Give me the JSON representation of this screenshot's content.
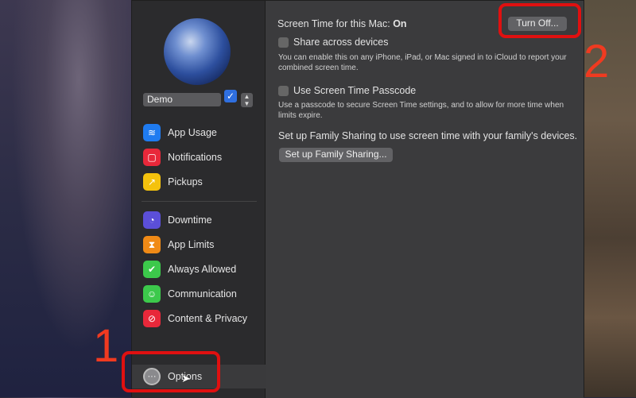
{
  "sidebar": {
    "user": "Demo",
    "groups": [
      {
        "label": "App Usage",
        "icon": "layers-icon",
        "color": "#1f7bf0"
      },
      {
        "label": "Notifications",
        "icon": "notification-icon",
        "color": "#e8283a"
      },
      {
        "label": "Pickups",
        "icon": "pickup-icon",
        "color": "#f4c20d"
      },
      {
        "label": "Downtime",
        "icon": "downtime-icon",
        "color": "#5b4fd8"
      },
      {
        "label": "App Limits",
        "icon": "hourglass-icon",
        "color": "#f08a16"
      },
      {
        "label": "Always Allowed",
        "icon": "checkmark-badge-icon",
        "color": "#3cc94b"
      },
      {
        "label": "Communication",
        "icon": "person-icon",
        "color": "#3cc94b"
      },
      {
        "label": "Content & Privacy",
        "icon": "prohibited-icon",
        "color": "#e8283a"
      }
    ],
    "options": "Options"
  },
  "main": {
    "status_label": "Screen Time for this Mac:",
    "status_value": "On",
    "turn_off": "Turn Off...",
    "share_label": "Share across devices",
    "share_desc": "You can enable this on any iPhone, iPad, or Mac signed in to iCloud to report your combined screen time.",
    "passcode_label": "Use Screen Time Passcode",
    "passcode_desc": "Use a passcode to secure Screen Time settings, and to allow for more time when limits expire.",
    "family_text": "Set up Family Sharing to use screen time with your family's devices.",
    "family_button": "Set up Family Sharing..."
  },
  "annotations": {
    "step1": "1",
    "step2": "2",
    "highlight_color": "#e01010"
  }
}
